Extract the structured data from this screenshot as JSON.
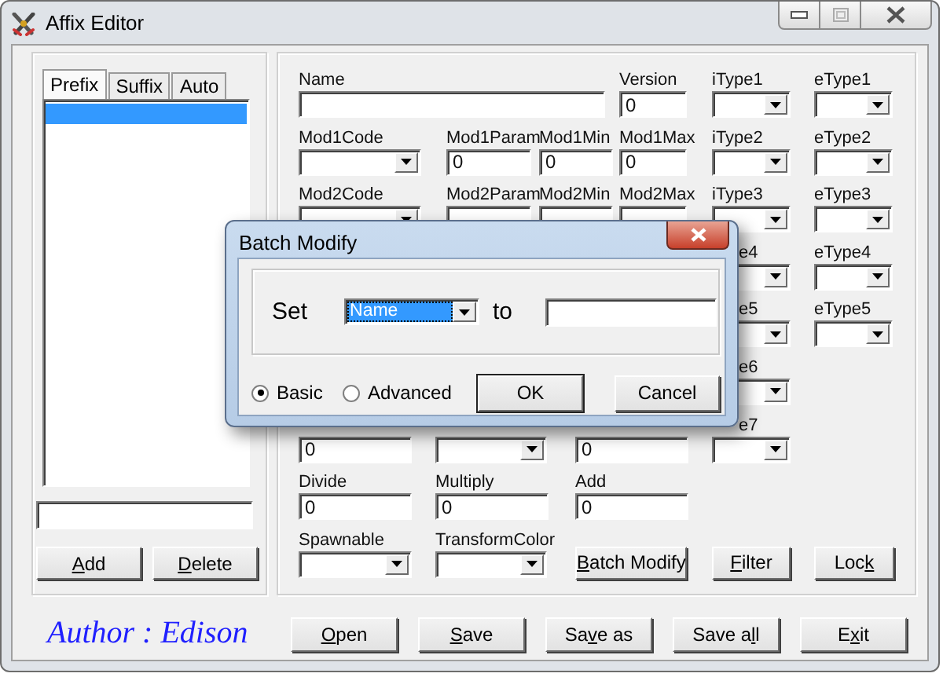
{
  "window": {
    "title": "Affix Editor"
  },
  "tabs": [
    {
      "label": "Prefix",
      "selected": true
    },
    {
      "label": "Suffix",
      "selected": false
    },
    {
      "label": "Auto",
      "selected": false
    }
  ],
  "affix_list": {
    "items": [
      {
        "selected": true
      }
    ]
  },
  "list_buttons": [
    {
      "key": "A",
      "post": "dd"
    },
    {
      "key": "D",
      "post": "elete"
    }
  ],
  "form": {
    "fields": [
      {
        "label": "Name",
        "kind": "text"
      },
      {
        "label": "Version",
        "kind": "text",
        "value": "0"
      },
      {
        "label": "iType1",
        "kind": "dropdown"
      },
      {
        "label": "eType1",
        "kind": "dropdown"
      },
      {
        "label": "Mod1Code",
        "kind": "dropdown"
      },
      {
        "label": "Mod1Param",
        "kind": "text",
        "value": "0"
      },
      {
        "label": "Mod1Min",
        "kind": "text",
        "value": "0"
      },
      {
        "label": "Mod1Max",
        "kind": "text",
        "value": "0"
      },
      {
        "label": "iType2",
        "kind": "dropdown"
      },
      {
        "label": "eType2",
        "kind": "dropdown"
      },
      {
        "label": "Mod2Code",
        "kind": "dropdown"
      },
      {
        "label": "Mod2Param",
        "kind": "text"
      },
      {
        "label": "Mod2Min",
        "kind": "text"
      },
      {
        "label": "Mod2Max",
        "kind": "text"
      },
      {
        "label": "iType3",
        "kind": "dropdown"
      },
      {
        "label": "eType3",
        "kind": "dropdown"
      },
      {
        "label": "e4",
        "kind": "dropdown"
      },
      {
        "label": "eType4",
        "kind": "dropdown"
      },
      {
        "label": "e5",
        "kind": "dropdown"
      },
      {
        "label": "eType5",
        "kind": "dropdown"
      },
      {
        "label": "e6",
        "kind": "dropdown"
      },
      {
        "kind": "text",
        "value": "0"
      },
      {
        "kind": "dropdown"
      },
      {
        "kind": "text",
        "value": "0"
      },
      {
        "label": "e7",
        "kind": "dropdown"
      },
      {
        "label": "Divide",
        "kind": "text",
        "value": "0"
      },
      {
        "label": "Multiply",
        "kind": "text",
        "value": "0"
      },
      {
        "label": "Add",
        "kind": "text",
        "value": "0"
      },
      {
        "label": "Spawnable",
        "kind": "dropdown"
      },
      {
        "label": "TransformColor",
        "kind": "dropdown"
      }
    ],
    "buttons": [
      {
        "key": "B",
        "post": "atch Modify"
      },
      {
        "key": "F",
        "post": "ilter"
      },
      {
        "pre": "Loc",
        "key": "k"
      }
    ]
  },
  "author": "Author : Edison",
  "bottom_buttons": [
    {
      "key": "O",
      "post": "pen"
    },
    {
      "key": "S",
      "post": "ave"
    },
    {
      "pre": "Sa",
      "key": "v",
      "post": "e as"
    },
    {
      "pre": "Save a",
      "key": "l",
      "post": "l"
    },
    {
      "pre": "E",
      "key": "x",
      "post": "it"
    }
  ],
  "dialog": {
    "title": "Batch Modify",
    "set_label": "Set",
    "property": "Name",
    "to_label": "to",
    "radios": [
      {
        "label": "Basic",
        "selected": true
      },
      {
        "label": "Advanced",
        "selected": false
      }
    ],
    "buttons": [
      {
        "label": "OK",
        "default": true
      },
      {
        "label": "Cancel",
        "default": false
      }
    ]
  }
}
